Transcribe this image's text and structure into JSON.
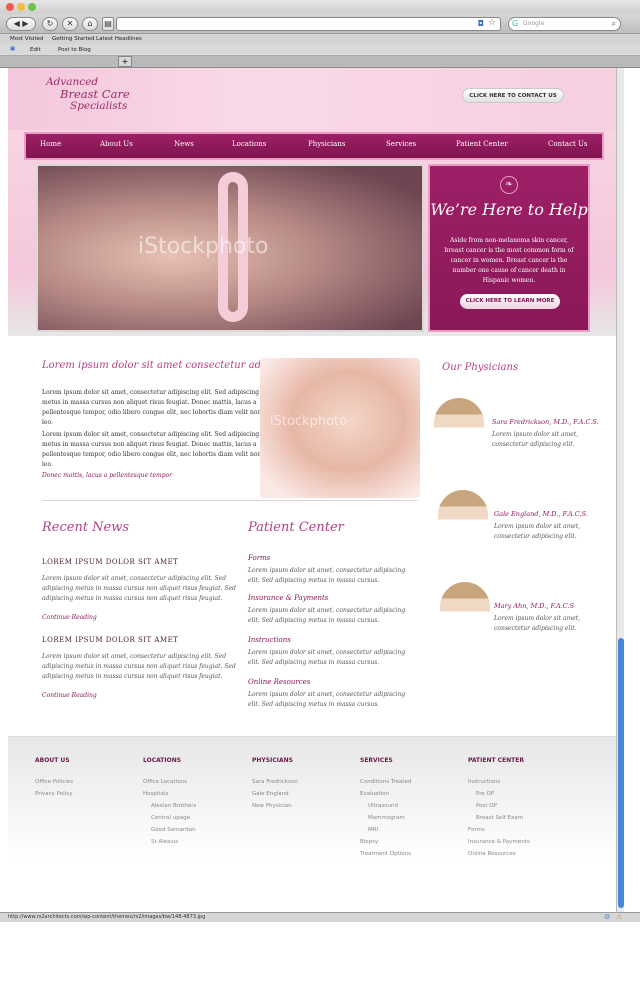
{
  "browser": {
    "search_placeholder": "Google",
    "bookmarks": [
      "Most Visited",
      "Getting Started",
      "Latest Headlines"
    ],
    "subbar": [
      "Edit",
      "Post to Blog"
    ],
    "new_tab": "+",
    "status_url": "http://www.rs2architects.com/wp-content/themes/rs2/images/bw/148-4873.jpg"
  },
  "header": {
    "logo_line1": "Advanced",
    "logo_line2": "Breast Care",
    "logo_line3": "Specialists",
    "contact_button": "CLICK HERE TO CONTACT US"
  },
  "nav": [
    "Home",
    "About Us",
    "News",
    "Locations",
    "Physicians",
    "Services",
    "Patient Center",
    "Contact Us"
  ],
  "hero": {
    "watermark": "iStockphoto",
    "title": "We’re Here to Help",
    "text": "Aside from non-melanoma skin cancer, breast cancer is the most common form of cancer in women. Breast cancer is the number one cause of cancer death in Hispanic women.",
    "button": "CLICK HERE TO LEARN MORE"
  },
  "intro": {
    "title": "Lorem ipsum dolor sit amet consectetur adipiscing elit",
    "p1": "Lorem ipsum dolor sit amet, consectetur adipiscing elit. Sed adipiscing metus in massa cursus non aliquet risus feugiat. Donec mattis, lacus a pellentesque tempor, odio libero congue elit, nec lobortis diam velit non leo.",
    "p2": "Lorem ipsum dolor sit amet, consectetur adipiscing elit. Sed adipiscing metus in massa cursus non aliquet risus feugiat. Donec mattis, lacus a pellentesque tempor, odio libero congue elit, nec lobortis diam velit non leo.",
    "link": "Donec mattis, lacus a pellentesque tempor",
    "watermark": "iStockphoto"
  },
  "news": {
    "title": "Recent News",
    "items": [
      {
        "heading": "LOREM IPSUM DOLOR SIT AMET",
        "text": "Lorem ipsum dolor sit amet, consectetur adipiscing elit. Sed adipiscing metus in massa cursus non aliquet risus feugiat. Sed adipiscing metus in massa cursus non aliquet risus feugiat.",
        "link": "Continue Reading"
      },
      {
        "heading": "LOREM IPSUM DOLOR SIT AMET",
        "text": "Lorem ipsum dolor sit amet, consectetur adipiscing elit. Sed adipiscing metus in massa cursus non aliquet risus feugiat. Sed adipiscing metus in massa cursus non aliquet risus feugiat.",
        "link": "Continue Reading"
      }
    ]
  },
  "patient_center": {
    "title": "Patient Center",
    "items": [
      {
        "heading": "Forms",
        "text": "Lorem ipsum dolor sit amet, consectetur adipiscing elit. Sed adipiscing metus in massa cursus."
      },
      {
        "heading": "Insurance & Payments",
        "text": "Lorem ipsum dolor sit amet, consectetur adipiscing elit. Sed adipiscing metus in massa cursus."
      },
      {
        "heading": "Instructions",
        "text": "Lorem ipsum dolor sit amet, consectetur adipiscing elit. Sed adipiscing metus in massa cursus."
      },
      {
        "heading": "Online Resources",
        "text": "Lorem ipsum dolor sit amet, consectetur adipiscing elit. Sed adipiscing metus in massa cursus."
      }
    ]
  },
  "physicians": {
    "title": "Our Physicians",
    "items": [
      {
        "name": "Sara Fredrickson, M.D., F.A.C.S.",
        "text": "Lorem ipsum dolor sit amet, consectetur adipiscing elit."
      },
      {
        "name": "Gale England, M.D., F.A.C.S.",
        "text": "Lorem ipsum dolor sit amet, consectetur adipiscing elit."
      },
      {
        "name": "Mary Ahn, M.D., F.A.C.S",
        "text": "Lorem ipsum dolor sit amet, consectetur adipiscing elit."
      }
    ]
  },
  "footer": {
    "about": {
      "title": "ABOUT US",
      "links": [
        "Office Policies",
        "Privacy Policy"
      ]
    },
    "locations": {
      "title": "LOCATIONS",
      "links": [
        "Office Locations",
        "Hospitals"
      ],
      "sublinks": [
        "Alexian Brothers",
        "Central upage",
        "Good Samaritan",
        "St Alexius"
      ]
    },
    "physicians": {
      "title": "PHYSICIANS",
      "links": [
        "Sara Fredrickson",
        "Gale England",
        "New Physician"
      ]
    },
    "services": {
      "title": "SERVICES",
      "links": [
        "Conditions Treated",
        "Evaluation"
      ],
      "sublinks": [
        "Ultrasound",
        "Mammogram",
        "MRI"
      ],
      "links2": [
        "Biopsy",
        "Treatment Options"
      ]
    },
    "patient": {
      "title": "PATIENT CENTER",
      "links": [
        "Instructions"
      ],
      "sublinks": [
        "Pre OP",
        "Post OP",
        "Breast Self Exam"
      ],
      "links2": [
        "Forms",
        "Insurance & Payments",
        "Online Resources"
      ]
    }
  }
}
